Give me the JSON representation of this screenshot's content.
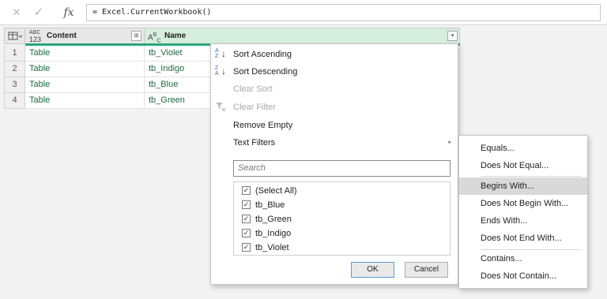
{
  "formula_bar": {
    "cancel_icon": "×",
    "enter_icon": "✓",
    "fx_label": "fx",
    "formula": "= Excel.CurrentWorkbook()"
  },
  "table": {
    "corner_icon": "table-menu-icon",
    "columns": [
      {
        "label": "Content",
        "type_icon_top": "ABC",
        "type_icon_bottom": "123",
        "filter_icon": "⊞"
      },
      {
        "label": "Name",
        "type_icon_top": "A",
        "type_icon_sup": "B",
        "type_icon_sub": "C",
        "filter_icon": "▾"
      }
    ],
    "rows": [
      {
        "num": "1",
        "content": "Table",
        "name": "tb_Violet"
      },
      {
        "num": "2",
        "content": "Table",
        "name": "tb_Indigo"
      },
      {
        "num": "3",
        "content": "Table",
        "name": "tb_Blue"
      },
      {
        "num": "4",
        "content": "Table",
        "name": "tb_Green"
      }
    ]
  },
  "menu": {
    "sort_ascending": "Sort Ascending",
    "sort_descending": "Sort Descending",
    "clear_sort": "Clear Sort",
    "clear_filter": "Clear Filter",
    "remove_empty": "Remove Empty",
    "text_filters": "Text Filters",
    "search_placeholder": "Search",
    "list_items": [
      "(Select All)",
      "tb_Blue",
      "tb_Green",
      "tb_Indigo",
      "tb_Violet"
    ],
    "ok_label": "OK",
    "cancel_label": "Cancel"
  },
  "submenu": {
    "items": [
      "Equals...",
      "Does Not Equal...",
      "Begins With...",
      "Does Not Begin With...",
      "Ends With...",
      "Does Not End With...",
      "Contains...",
      "Does Not Contain..."
    ],
    "highlighted": "Begins With..."
  },
  "colors": {
    "accent": "#2aa57e",
    "selected_header": "#d6eedd",
    "cell_text": "#1e6b3f",
    "highlight": "#d9d9d9"
  }
}
